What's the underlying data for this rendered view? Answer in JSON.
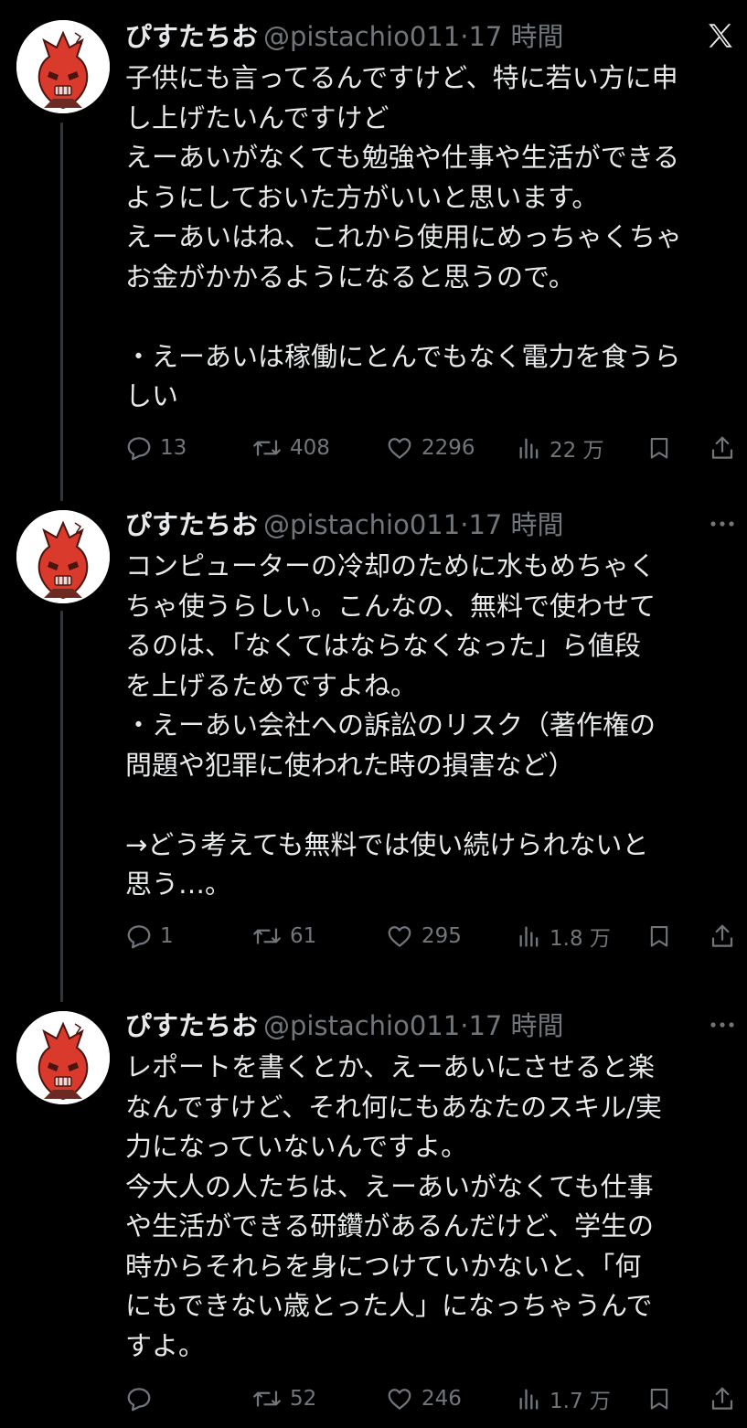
{
  "app": {
    "brand_icon": "x-logo-icon"
  },
  "colors": {
    "background": "#000000",
    "primary_text": "#e7e9ea",
    "secondary_text": "#71767b",
    "thread_line": "#333639",
    "avatar_red": "#d93a2b"
  },
  "icons": {
    "reply": "reply-icon",
    "retweet": "retweet-icon",
    "like": "heart-icon",
    "views": "views-icon",
    "bookmark": "bookmark-icon",
    "share": "share-icon",
    "more": "more-icon"
  },
  "tweets": [
    {
      "author_name": "ぴすたちお",
      "handle": "@pistachio011",
      "separator": "·",
      "time": "17 時間",
      "lines": [
        "子供にも言ってるんですけど、特に若い方に申",
        "し上げたいんですけど",
        "えーあいがなくても勉強や仕事や生活ができる",
        "ようにしておいた方がいいと思います。",
        "えーあいはね、これから使用にめっちゃくちゃ",
        "お金がかかるようになると思うので。",
        "",
        "・えーあいは稼働にとんでもなく電力を食うら",
        "しい"
      ],
      "replies": "13",
      "retweets": "408",
      "likes": "2296",
      "views": "22 万"
    },
    {
      "author_name": "ぴすたちお",
      "handle": "@pistachio011",
      "separator": "·",
      "time": "17 時間",
      "lines": [
        "コンピューターの冷却のために水もめちゃく",
        "ちゃ使うらしい。こんなの、無料で使わせて",
        "るのは、「なくてはならなくなった」ら値段",
        "を上げるためですよね。",
        "・えーあい会社への訴訟のリスク（著作権の",
        "問題や犯罪に使われた時の損害など）",
        "",
        "→どう考えても無料では使い続けられないと",
        "思う…。"
      ],
      "replies": "1",
      "retweets": "61",
      "likes": "295",
      "views": "1.8 万"
    },
    {
      "author_name": "ぴすたちお",
      "handle": "@pistachio011",
      "separator": "·",
      "time": "17 時間",
      "lines": [
        "レポートを書くとか、えーあいにさせると楽",
        "なんですけど、それ何にもあなたのスキル/実",
        "力になっていないんですよ。",
        "今大人の人たちは、えーあいがなくても仕事",
        "や生活ができる研鑽があるんだけど、学生の",
        "時からそれらを身につけていかないと、「何",
        "にもできない歳とった人」になっちゃうんで",
        "すよ。"
      ],
      "replies": "",
      "retweets": "52",
      "likes": "246",
      "views": "1.7 万"
    }
  ]
}
